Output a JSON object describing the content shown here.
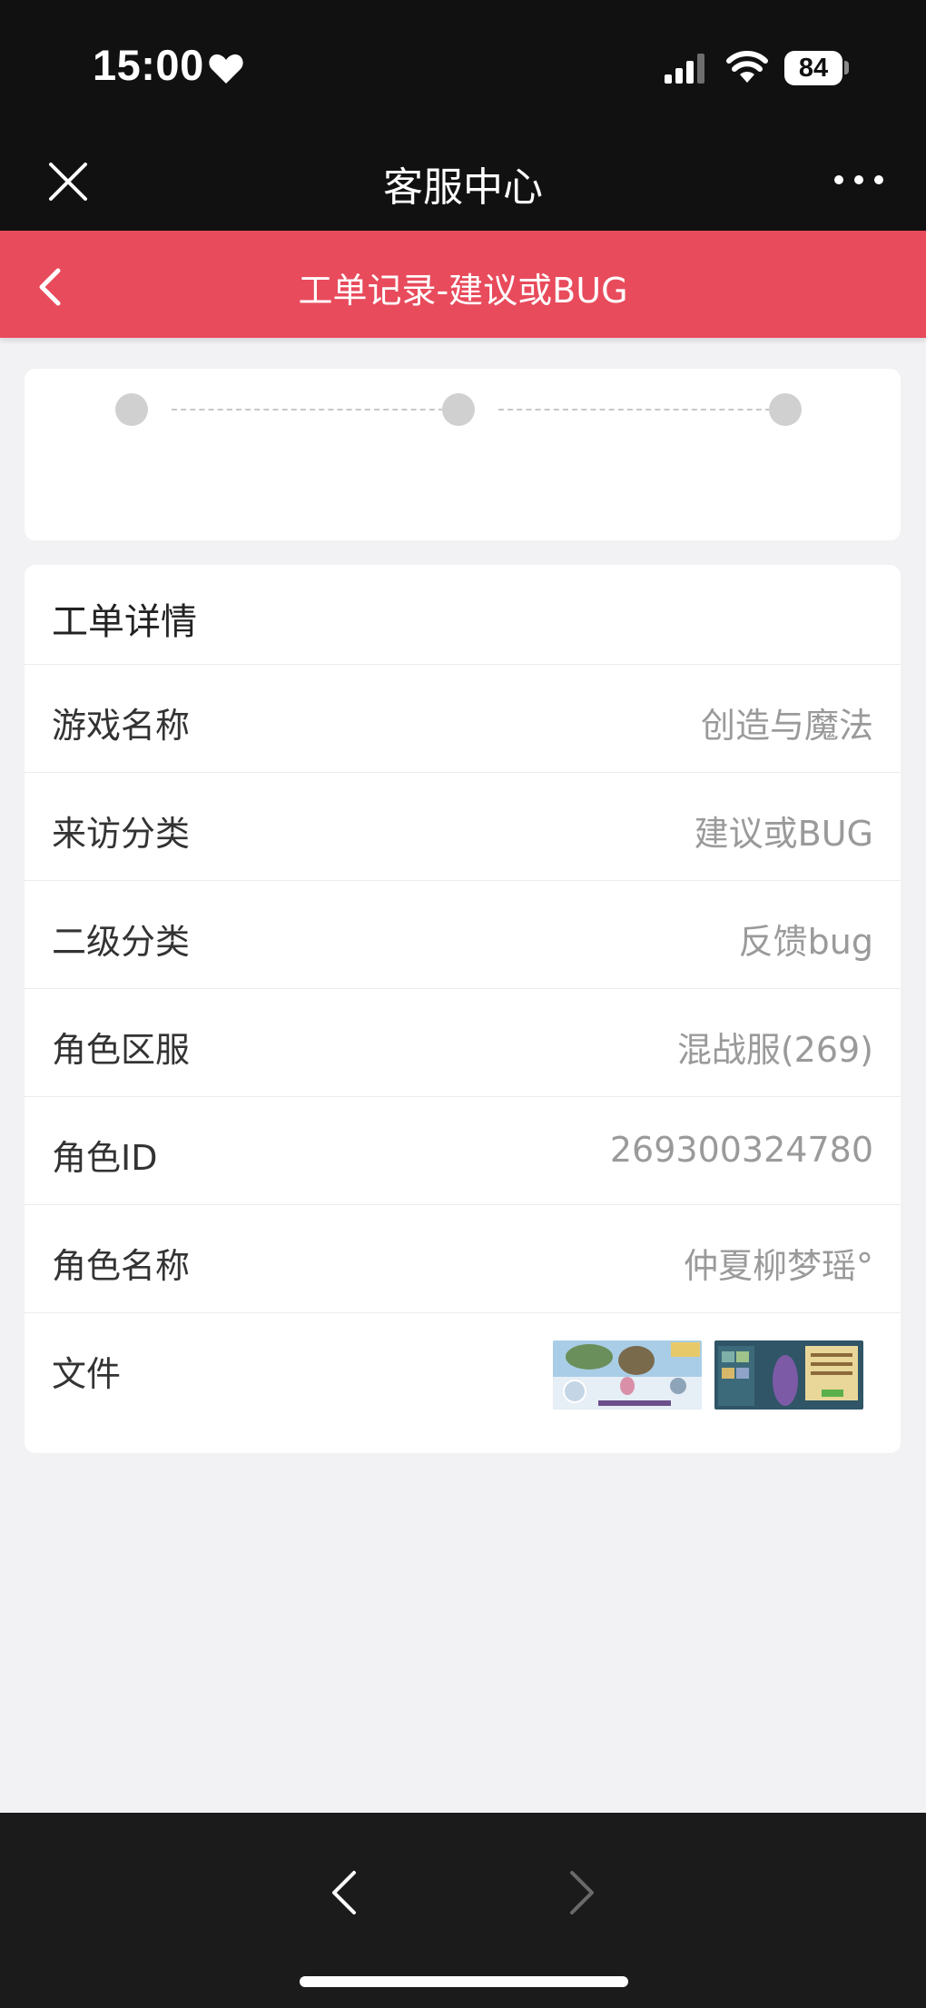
{
  "status_bar": {
    "time": "15:00",
    "battery": "84"
  },
  "top_nav": {
    "title": "客服中心"
  },
  "header": {
    "title": "工单记录-建议或BUG"
  },
  "details": {
    "section_title": "工单详情",
    "rows": [
      {
        "label": "游戏名称",
        "value": "创造与魔法"
      },
      {
        "label": "来访分类",
        "value": "建议或BUG"
      },
      {
        "label": "二级分类",
        "value": "反馈bug"
      },
      {
        "label": "角色区服",
        "value": "混战服(269)"
      },
      {
        "label": "角色ID",
        "value": "269300324780"
      },
      {
        "label": "角色名称",
        "value": "仲夏柳梦瑶°"
      },
      {
        "label": "文件",
        "value": ""
      }
    ]
  },
  "colors": {
    "accent": "#e84b5c",
    "background": "#f2f2f4",
    "bar": "#111111"
  }
}
